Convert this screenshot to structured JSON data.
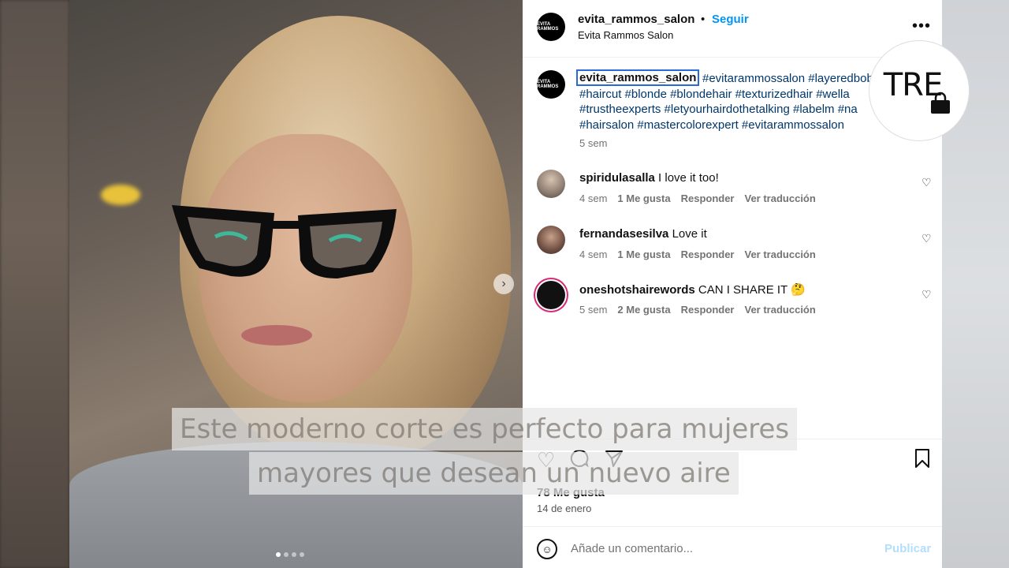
{
  "post": {
    "username": "evita_rammos_salon",
    "follow_label": "Seguir",
    "separator": "•",
    "subtitle": "Evita Rammos Salon",
    "avatar_text": "EVITA RAMMOS",
    "more_label": "•••"
  },
  "caption": {
    "username": "evita_rammos_salon",
    "tags": "#evitarammossalon #layeredbob #haircut #blonde #blondehair #texturizedhair #wella #trustheexperts #letyourhairdothetalking #labelm #na #hairsalon #mastercolorexpert #evitarammossalon",
    "time": "5 sem"
  },
  "comments": [
    {
      "username": "spiridulasalla",
      "text": "I love it too!",
      "time": "4 sem",
      "likes": "1 Me gusta",
      "reply": "Responder",
      "translate": "Ver traducción"
    },
    {
      "username": "fernandasesilva",
      "text": "Love it",
      "time": "4 sem",
      "likes": "1 Me gusta",
      "reply": "Responder",
      "translate": "Ver traducción"
    },
    {
      "username": "oneshotshairewords",
      "text": "CAN I SHARE IT 🤔",
      "time": "5 sem",
      "likes": "2 Me gusta",
      "reply": "Responder",
      "translate": "Ver traducción"
    }
  ],
  "footer": {
    "likes": "78 Me gusta",
    "date": "14 de enero",
    "comment_placeholder": "Añade un comentario...",
    "publish_label": "Publicar"
  },
  "overlay": {
    "logo_text": "TRE",
    "subtitle_line1": "Este moderno corte es perfecto para mujeres",
    "subtitle_line2": "mayores que desean un nuevo aire"
  },
  "carousel": {
    "total": 4,
    "active": 1
  },
  "colors": {
    "link": "#00376b",
    "follow": "#0095f6",
    "muted": "#737373"
  },
  "icons": [
    "heart-icon",
    "comment-icon",
    "share-icon",
    "bookmark-icon",
    "emoji-icon",
    "more-icon",
    "chevron-right-icon"
  ]
}
